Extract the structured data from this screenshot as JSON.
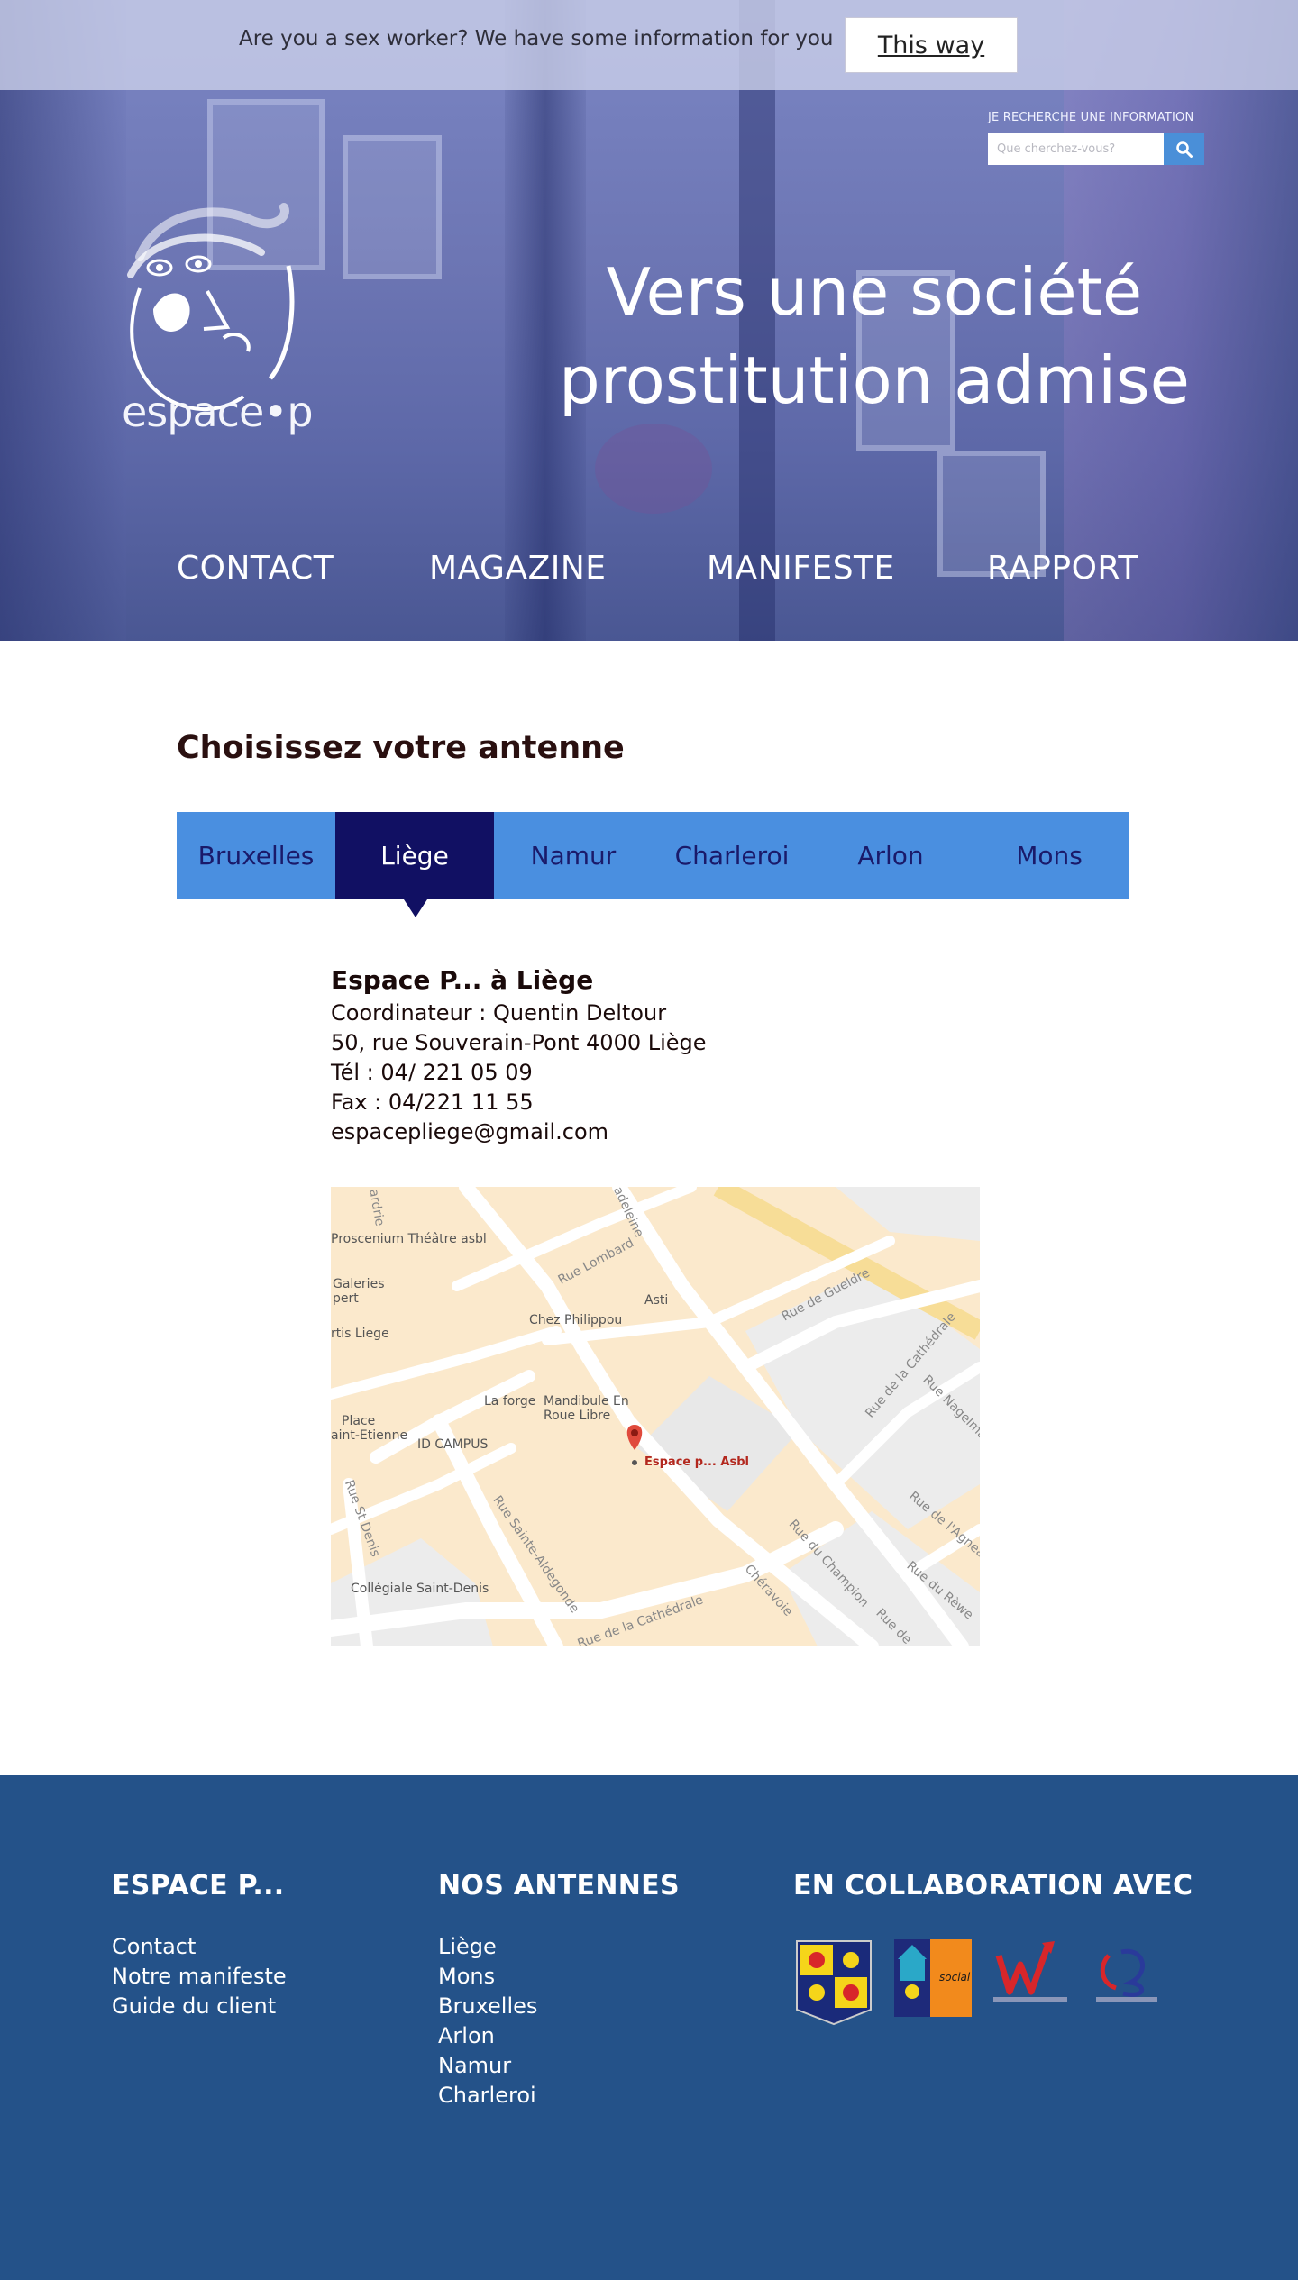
{
  "notice": {
    "text": "Are you a sex worker? We have some information for you",
    "button_label": "This way"
  },
  "search": {
    "label": "JE RECHERCHE UNE INFORMATION",
    "placeholder": "Que cherchez-vous?",
    "button_icon": "search-icon"
  },
  "logo": {
    "text": "espace•p"
  },
  "hero": {
    "title_line1": "Vers une société",
    "title_line2": "prostitution admise"
  },
  "nav": {
    "items": [
      "CONTACT",
      "MAGAZINE",
      "MANIFESTE",
      "RAPPORT"
    ]
  },
  "antenne": {
    "title": "Choisissez votre antenne",
    "tabs": [
      "Bruxelles",
      "Liège",
      "Namur",
      "Charleroi",
      "Arlon",
      "Mons"
    ],
    "active_tab": "Liège"
  },
  "office": {
    "title": "Espace P... à Liège",
    "coordinator": "Coordinateur : Quentin Deltour",
    "address": "50, rue Souverain-Pont 4000 Liège",
    "phone": "Tél : 04/ 221 05 09",
    "fax": "Fax : 04/221 11 55",
    "email": "espacepliege@gmail.com"
  },
  "map": {
    "marker_label": "Espace p... Asbl",
    "places": [
      "Proscenium Théâtre asbl",
      "Galeries",
      "pert",
      "rtis Liege",
      "Chez Philippou",
      "Asti",
      "La forge",
      "Mandibule En",
      "Roue Libre",
      "Place",
      "aint-Etienne",
      "ID CAMPUS",
      "Collégiale Saint-Denis"
    ],
    "streets": [
      "Rue Lombard",
      "Rue de Gueldre",
      "Rue de la Cathédrale",
      "Rue Nagelmackers",
      "Rue de l'Agneau",
      "Rue du Rèwe",
      "Rue du Champion",
      "Chéravoie",
      "Rue de la Cathédrale",
      "Rue Sainte-Aldegonde",
      "Rue St Denis",
      "adeleine",
      "ardrie",
      "Rue de"
    ]
  },
  "footer": {
    "col1": {
      "heading": "ESPACE P...",
      "links": [
        "Contact",
        "Notre manifeste",
        "Guide du client"
      ]
    },
    "col2": {
      "heading": "NOS ANTENNES",
      "links": [
        "Liège",
        "Mons",
        "Bruxelles",
        "Arlon",
        "Namur",
        "Charleroi"
      ]
    },
    "col3": {
      "heading": "EN COLLABORATION AVEC",
      "partners": [
        "wallonia-brussels-federation-logo",
        "action-sociale-logo",
        "wallonie-logo",
        "federal-logo"
      ]
    }
  },
  "colors": {
    "tab_bar": "#4a8fe0",
    "tab_active": "#111063",
    "footer_bg": "#245289",
    "search_button": "#4a8fd8"
  }
}
